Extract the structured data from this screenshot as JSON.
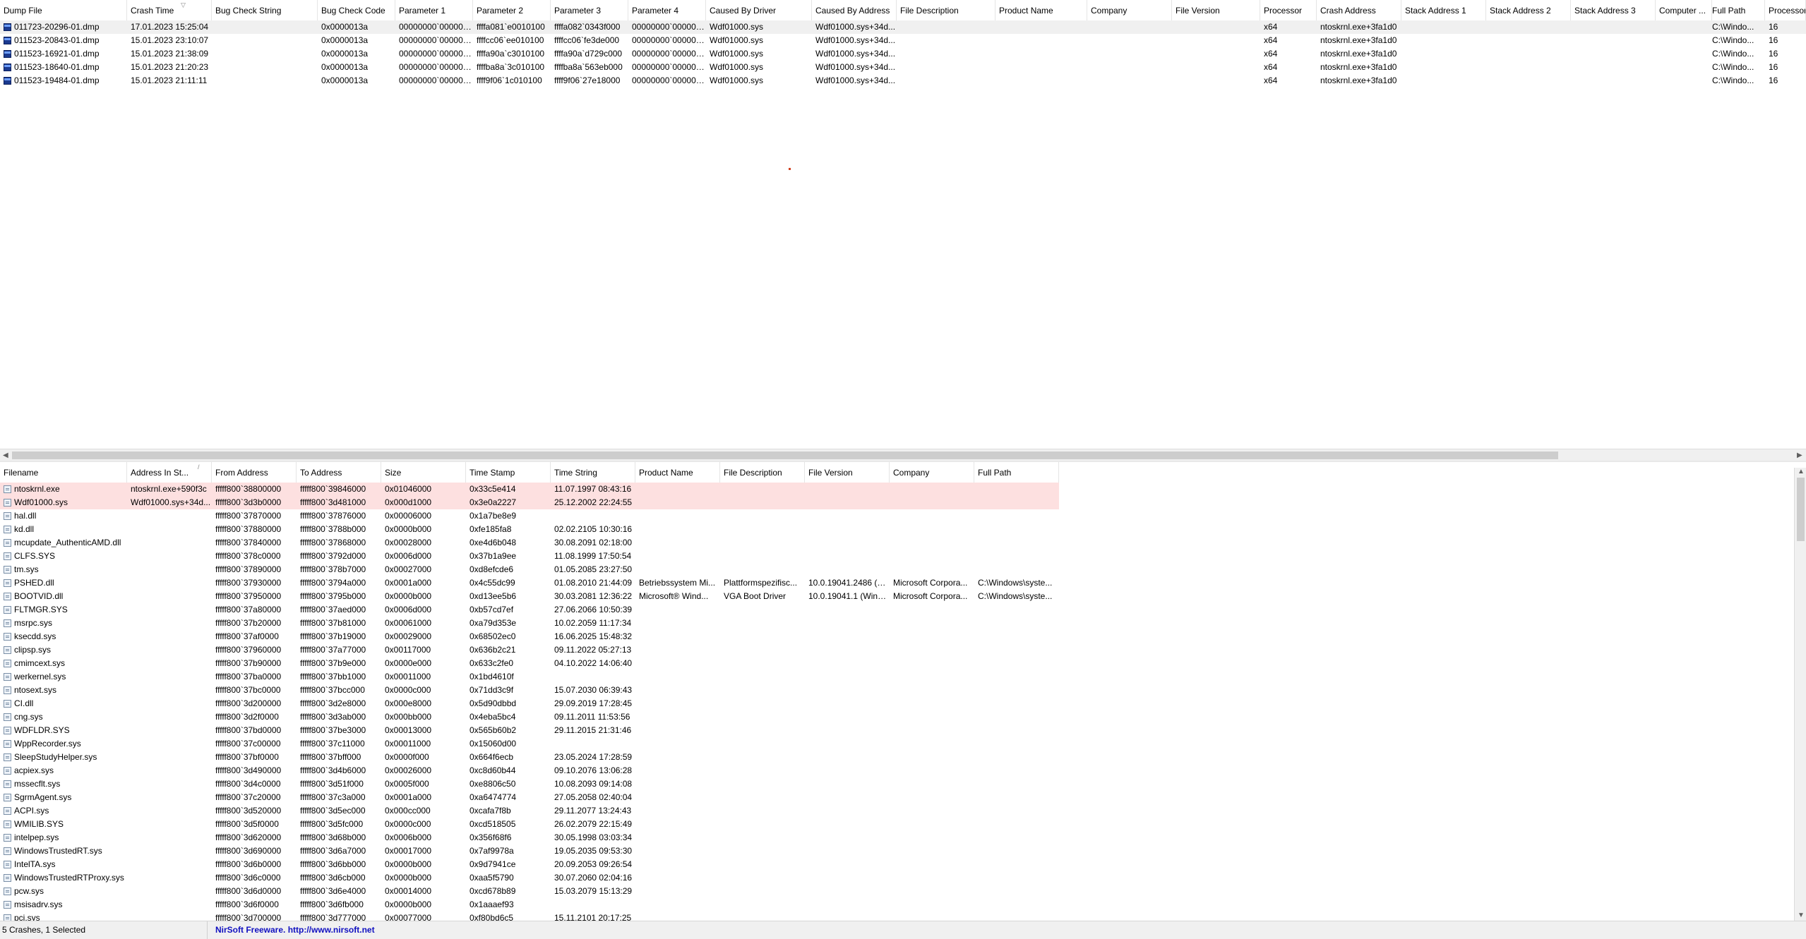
{
  "top_table": {
    "columns": [
      "Dump File",
      "Crash Time",
      "Bug Check String",
      "Bug Check Code",
      "Parameter 1",
      "Parameter 2",
      "Parameter 3",
      "Parameter 4",
      "Caused By Driver",
      "Caused By Address",
      "File Description",
      "Product Name",
      "Company",
      "File Version",
      "Processor",
      "Crash Address",
      "Stack Address 1",
      "Stack Address 2",
      "Stack Address 3",
      "Computer ...",
      "Full Path",
      "Processor"
    ],
    "sort_indicator": "▽",
    "rows": [
      [
        "011723-20296-01.dmp",
        "17.01.2023 15:25:04",
        "",
        "0x0000013a",
        "00000000`000000...",
        "ffffa081`e0010100",
        "ffffa082`0343f000",
        "00000000`000000...",
        "Wdf01000.sys",
        "Wdf01000.sys+34d...",
        "",
        "",
        "",
        "",
        "x64",
        "ntoskrnl.exe+3fa1d0",
        "",
        "",
        "",
        "",
        "C:\\Windo...",
        "16"
      ],
      [
        "011523-20843-01.dmp",
        "15.01.2023 23:10:07",
        "",
        "0x0000013a",
        "00000000`000000...",
        "ffffcc06`ee010100",
        "ffffcc06`fe3de000",
        "00000000`000000...",
        "Wdf01000.sys",
        "Wdf01000.sys+34d...",
        "",
        "",
        "",
        "",
        "x64",
        "ntoskrnl.exe+3fa1d0",
        "",
        "",
        "",
        "",
        "C:\\Windo...",
        "16"
      ],
      [
        "011523-16921-01.dmp",
        "15.01.2023 21:38:09",
        "",
        "0x0000013a",
        "00000000`000000...",
        "ffffa90a`c3010100",
        "ffffa90a`d729c000",
        "00000000`000000...",
        "Wdf01000.sys",
        "Wdf01000.sys+34d...",
        "",
        "",
        "",
        "",
        "x64",
        "ntoskrnl.exe+3fa1d0",
        "",
        "",
        "",
        "",
        "C:\\Windo...",
        "16"
      ],
      [
        "011523-18640-01.dmp",
        "15.01.2023 21:20:23",
        "",
        "0x0000013a",
        "00000000`000000...",
        "ffffba8a`3c010100",
        "ffffba8a`563eb000",
        "00000000`000000...",
        "Wdf01000.sys",
        "Wdf01000.sys+34d...",
        "",
        "",
        "",
        "",
        "x64",
        "ntoskrnl.exe+3fa1d0",
        "",
        "",
        "",
        "",
        "C:\\Windo...",
        "16"
      ],
      [
        "011523-19484-01.dmp",
        "15.01.2023 21:11:11",
        "",
        "0x0000013a",
        "00000000`000000...",
        "ffff9f06`1c010100",
        "ffff9f06`27e18000",
        "00000000`000000...",
        "Wdf01000.sys",
        "Wdf01000.sys+34d...",
        "",
        "",
        "",
        "",
        "x64",
        "ntoskrnl.exe+3fa1d0",
        "",
        "",
        "",
        "",
        "C:\\Windo...",
        "16"
      ]
    ]
  },
  "bottom_table": {
    "columns": [
      "Filename",
      "Address In St...",
      "From Address",
      "To Address",
      "Size",
      "Time Stamp",
      "Time String",
      "Product Name",
      "File Description",
      "File Version",
      "Company",
      "Full Path"
    ],
    "sort_indicator": "/",
    "rows": [
      [
        "ntoskrnl.exe",
        "ntoskrnl.exe+590f3c",
        "fffff800`38800000",
        "fffff800`39846000",
        "0x01046000",
        "0x33c5e414",
        "11.07.1997 08:43:16",
        "",
        "",
        "",
        "",
        ""
      ],
      [
        "Wdf01000.sys",
        "Wdf01000.sys+34d...",
        "fffff800`3d3b0000",
        "fffff800`3d481000",
        "0x000d1000",
        "0x3e0a2227",
        "25.12.2002 22:24:55",
        "",
        "",
        "",
        "",
        ""
      ],
      [
        "hal.dll",
        "",
        "fffff800`37870000",
        "fffff800`37876000",
        "0x00006000",
        "0x1a7be8e9",
        "",
        "",
        "",
        "",
        "",
        ""
      ],
      [
        "kd.dll",
        "",
        "fffff800`37880000",
        "fffff800`3788b000",
        "0x0000b000",
        "0xfe185fa8",
        "02.02.2105 10:30:16",
        "",
        "",
        "",
        "",
        ""
      ],
      [
        "mcupdate_AuthenticAMD.dll",
        "",
        "fffff800`37840000",
        "fffff800`37868000",
        "0x00028000",
        "0xe4d6b048",
        "30.08.2091 02:18:00",
        "",
        "",
        "",
        "",
        ""
      ],
      [
        "CLFS.SYS",
        "",
        "fffff800`378c0000",
        "fffff800`3792d000",
        "0x0006d000",
        "0x37b1a9ee",
        "11.08.1999 17:50:54",
        "",
        "",
        "",
        "",
        ""
      ],
      [
        "tm.sys",
        "",
        "fffff800`37890000",
        "fffff800`378b7000",
        "0x00027000",
        "0xd8efcde6",
        "01.05.2085 23:27:50",
        "",
        "",
        "",
        "",
        ""
      ],
      [
        "PSHED.dll",
        "",
        "fffff800`37930000",
        "fffff800`3794a000",
        "0x0001a000",
        "0x4c55dc99",
        "01.08.2010 21:44:09",
        "Betriebssystem Mi...",
        "Plattformspezifisc...",
        "10.0.19041.2486 (W...",
        "Microsoft Corpora...",
        "C:\\Windows\\syste..."
      ],
      [
        "BOOTVID.dll",
        "",
        "fffff800`37950000",
        "fffff800`3795b000",
        "0x0000b000",
        "0xd13ee5b6",
        "30.03.2081 12:36:22",
        "Microsoft® Wind...",
        "VGA Boot Driver",
        "10.0.19041.1 (WinB...",
        "Microsoft Corpora...",
        "C:\\Windows\\syste..."
      ],
      [
        "FLTMGR.SYS",
        "",
        "fffff800`37a80000",
        "fffff800`37aed000",
        "0x0006d000",
        "0xb57cd7ef",
        "27.06.2066 10:50:39",
        "",
        "",
        "",
        "",
        ""
      ],
      [
        "msrpc.sys",
        "",
        "fffff800`37b20000",
        "fffff800`37b81000",
        "0x00061000",
        "0xa79d353e",
        "10.02.2059 11:17:34",
        "",
        "",
        "",
        "",
        ""
      ],
      [
        "ksecdd.sys",
        "",
        "fffff800`37af0000",
        "fffff800`37b19000",
        "0x00029000",
        "0x68502ec0",
        "16.06.2025 15:48:32",
        "",
        "",
        "",
        "",
        ""
      ],
      [
        "clipsp.sys",
        "",
        "fffff800`37960000",
        "fffff800`37a77000",
        "0x00117000",
        "0x636b2c21",
        "09.11.2022 05:27:13",
        "",
        "",
        "",
        "",
        ""
      ],
      [
        "cmimcext.sys",
        "",
        "fffff800`37b90000",
        "fffff800`37b9e000",
        "0x0000e000",
        "0x633c2fe0",
        "04.10.2022 14:06:40",
        "",
        "",
        "",
        "",
        ""
      ],
      [
        "werkernel.sys",
        "",
        "fffff800`37ba0000",
        "fffff800`37bb1000",
        "0x00011000",
        "0x1bd4610f",
        "",
        "",
        "",
        "",
        "",
        ""
      ],
      [
        "ntosext.sys",
        "",
        "fffff800`37bc0000",
        "fffff800`37bcc000",
        "0x0000c000",
        "0x71dd3c9f",
        "15.07.2030 06:39:43",
        "",
        "",
        "",
        "",
        ""
      ],
      [
        "CI.dll",
        "",
        "fffff800`3d200000",
        "fffff800`3d2e8000",
        "0x000e8000",
        "0x5d90dbbd",
        "29.09.2019 17:28:45",
        "",
        "",
        "",
        "",
        ""
      ],
      [
        "cng.sys",
        "",
        "fffff800`3d2f0000",
        "fffff800`3d3ab000",
        "0x000bb000",
        "0x4eba5bc4",
        "09.11.2011 11:53:56",
        "",
        "",
        "",
        "",
        ""
      ],
      [
        "WDFLDR.SYS",
        "",
        "fffff800`37bd0000",
        "fffff800`37be3000",
        "0x00013000",
        "0x565b60b2",
        "29.11.2015 21:31:46",
        "",
        "",
        "",
        "",
        ""
      ],
      [
        "WppRecorder.sys",
        "",
        "fffff800`37c00000",
        "fffff800`37c11000",
        "0x00011000",
        "0x15060d00",
        "",
        "",
        "",
        "",
        "",
        ""
      ],
      [
        "SleepStudyHelper.sys",
        "",
        "fffff800`37bf0000",
        "fffff800`37bff000",
        "0x0000f000",
        "0x664f6ecb",
        "23.05.2024 17:28:59",
        "",
        "",
        "",
        "",
        ""
      ],
      [
        "acpiex.sys",
        "",
        "fffff800`3d490000",
        "fffff800`3d4b6000",
        "0x00026000",
        "0xc8d60b44",
        "09.10.2076 13:06:28",
        "",
        "",
        "",
        "",
        ""
      ],
      [
        "mssecflt.sys",
        "",
        "fffff800`3d4c0000",
        "fffff800`3d51f000",
        "0x0005f000",
        "0xe8806c50",
        "10.08.2093 09:14:08",
        "",
        "",
        "",
        "",
        ""
      ],
      [
        "SgrmAgent.sys",
        "",
        "fffff800`37c20000",
        "fffff800`37c3a000",
        "0x0001a000",
        "0xa6474774",
        "27.05.2058 02:40:04",
        "",
        "",
        "",
        "",
        ""
      ],
      [
        "ACPI.sys",
        "",
        "fffff800`3d520000",
        "fffff800`3d5ec000",
        "0x000cc000",
        "0xcafa7f8b",
        "29.11.2077 13:24:43",
        "",
        "",
        "",
        "",
        ""
      ],
      [
        "WMILIB.SYS",
        "",
        "fffff800`3d5f0000",
        "fffff800`3d5fc000",
        "0x0000c000",
        "0xcd518505",
        "26.02.2079 22:15:49",
        "",
        "",
        "",
        "",
        ""
      ],
      [
        "intelpep.sys",
        "",
        "fffff800`3d620000",
        "fffff800`3d68b000",
        "0x0006b000",
        "0x356f68f6",
        "30.05.1998 03:03:34",
        "",
        "",
        "",
        "",
        ""
      ],
      [
        "WindowsTrustedRT.sys",
        "",
        "fffff800`3d690000",
        "fffff800`3d6a7000",
        "0x00017000",
        "0x7af9978a",
        "19.05.2035 09:53:30",
        "",
        "",
        "",
        "",
        ""
      ],
      [
        "IntelTA.sys",
        "",
        "fffff800`3d6b0000",
        "fffff800`3d6bb000",
        "0x0000b000",
        "0x9d7941ce",
        "20.09.2053 09:26:54",
        "",
        "",
        "",
        "",
        ""
      ],
      [
        "WindowsTrustedRTProxy.sys",
        "",
        "fffff800`3d6c0000",
        "fffff800`3d6cb000",
        "0x0000b000",
        "0xaa5f5790",
        "30.07.2060 02:04:16",
        "",
        "",
        "",
        "",
        ""
      ],
      [
        "pcw.sys",
        "",
        "fffff800`3d6d0000",
        "fffff800`3d6e4000",
        "0x00014000",
        "0xcd678b89",
        "15.03.2079 15:13:29",
        "",
        "",
        "",
        "",
        ""
      ],
      [
        "msisadrv.sys",
        "",
        "fffff800`3d6f0000",
        "fffff800`3d6fb000",
        "0x0000b000",
        "0x1aaaef93",
        "",
        "",
        "",
        "",
        "",
        ""
      ],
      [
        "pci.sys",
        "",
        "fffff800`3d700000",
        "fffff800`3d777000",
        "0x00077000",
        "0xf80bd6c5",
        "15.11.2101 20:17:25",
        "",
        "",
        "",
        "",
        ""
      ]
    ]
  },
  "status": {
    "crash_summary": "5 Crashes, 1 Selected",
    "freeware_text": "NirSoft Freeware.  ",
    "link_text": "http://www.nirsoft.net"
  }
}
